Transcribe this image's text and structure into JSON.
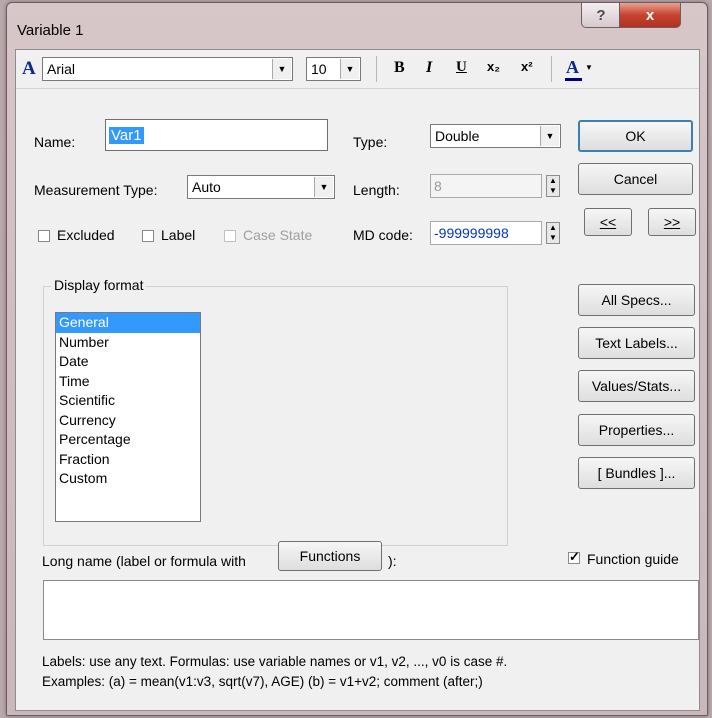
{
  "window": {
    "title": "Variable 1",
    "help_label": "?",
    "close_label": "x"
  },
  "toolbar": {
    "font_icon": "A",
    "font_name": "Arial",
    "font_size": "10",
    "bold_label": "B",
    "italic_label": "I",
    "underline_label": "U",
    "subscript_label": "x₂",
    "superscript_label": "x²",
    "font_color_label": "A",
    "font_color": "#000080"
  },
  "form": {
    "name_label": "Name:",
    "name_value": "Var1",
    "type_label": "Type:",
    "type_value": "Double",
    "measurement_label": "Measurement Type:",
    "measurement_value": "Auto",
    "length_label": "Length:",
    "length_value": "8",
    "excluded_label": "Excluded",
    "label_label": "Label",
    "case_state_label": "Case State",
    "md_code_label": "MD code:",
    "md_code_value": "-999999998"
  },
  "buttons": {
    "ok": "OK",
    "cancel": "Cancel",
    "prev": "<<",
    "next": ">>",
    "all_specs": "All Specs...",
    "text_labels": "Text Labels...",
    "values_stats": "Values/Stats...",
    "properties": "Properties...",
    "bundles": "[ Bundles ]...",
    "functions": "Functions"
  },
  "display_format": {
    "title": "Display format",
    "items": [
      "General",
      "Number",
      "Date",
      "Time",
      "Scientific",
      "Currency",
      "Percentage",
      "Fraction",
      "Custom"
    ],
    "selected_index": 0
  },
  "long_name": {
    "label_before": "Long name (label or formula with",
    "label_after": "):",
    "function_guide_label": "Function guide",
    "function_guide_checked": true,
    "value": ""
  },
  "hints": {
    "line1": "Labels: use any text.  Formulas: use variable names or v1, v2, ..., v0 is case #.",
    "line2": "Examples:   (a) = mean(v1:v3, sqrt(v7), AGE)   (b) = v1+v2; comment (after;)"
  },
  "colors": {
    "selection": "#3399ff",
    "accent_text": "#0033cc",
    "title_close": "#c5432f"
  }
}
